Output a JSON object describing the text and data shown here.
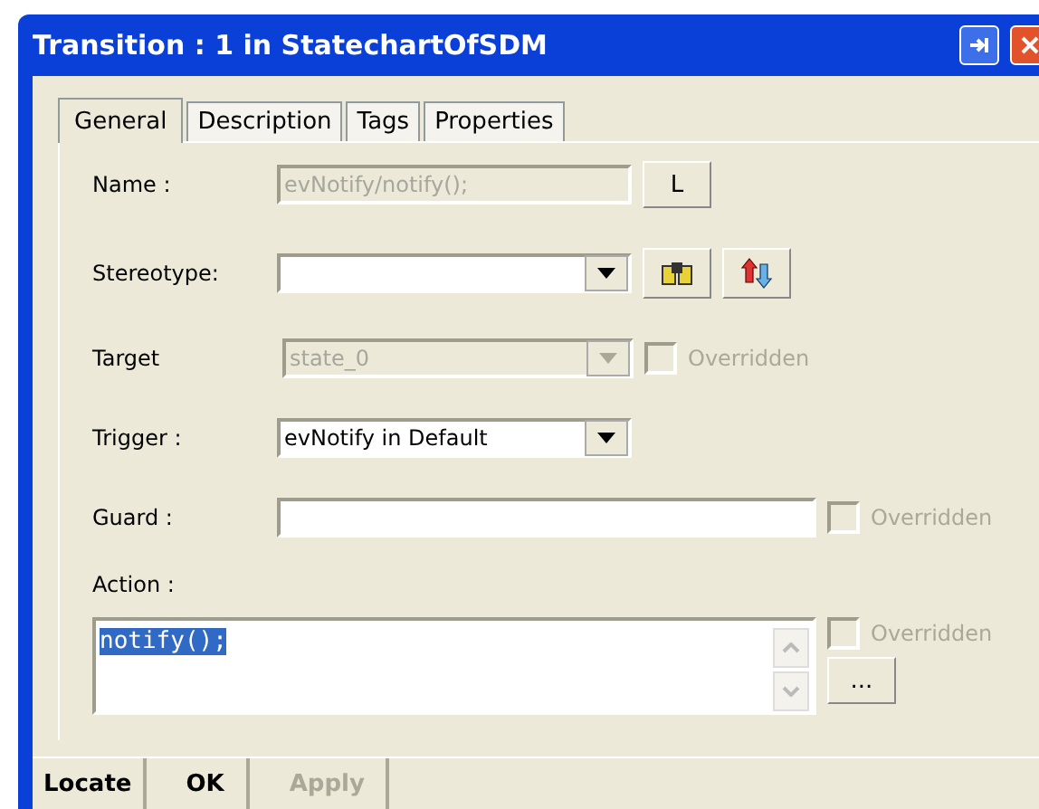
{
  "window": {
    "title": "Transition : 1 in StatechartOfSDM"
  },
  "tabs": [
    {
      "label": "General",
      "selected": true
    },
    {
      "label": "Description",
      "selected": false
    },
    {
      "label": "Tags",
      "selected": false
    },
    {
      "label": "Properties",
      "selected": false
    }
  ],
  "name": {
    "label": "Name :",
    "value": "evNotify/notify();",
    "disabled": true,
    "button": "L"
  },
  "stereotype": {
    "label": "Stereotype:"
  },
  "target": {
    "label": "Target",
    "value": "state_0",
    "disabled": true,
    "override": {
      "label": "Overridden",
      "checked": false,
      "disabled": true
    }
  },
  "trigger": {
    "label": "Trigger :",
    "value": "evNotify in Default",
    "disabled": false
  },
  "guard": {
    "label": "Guard :",
    "override": {
      "label": "Overridden",
      "checked": false,
      "disabled": true
    }
  },
  "action": {
    "label": "Action :",
    "value": "notify();",
    "selected": true,
    "override": {
      "label": "Overridden",
      "checked": false,
      "disabled": true
    },
    "button": "..."
  },
  "buttons": [
    {
      "label": "Locate",
      "disabled": false
    },
    {
      "label": "OK",
      "disabled": false
    },
    {
      "label": "Apply",
      "disabled": true
    }
  ]
}
